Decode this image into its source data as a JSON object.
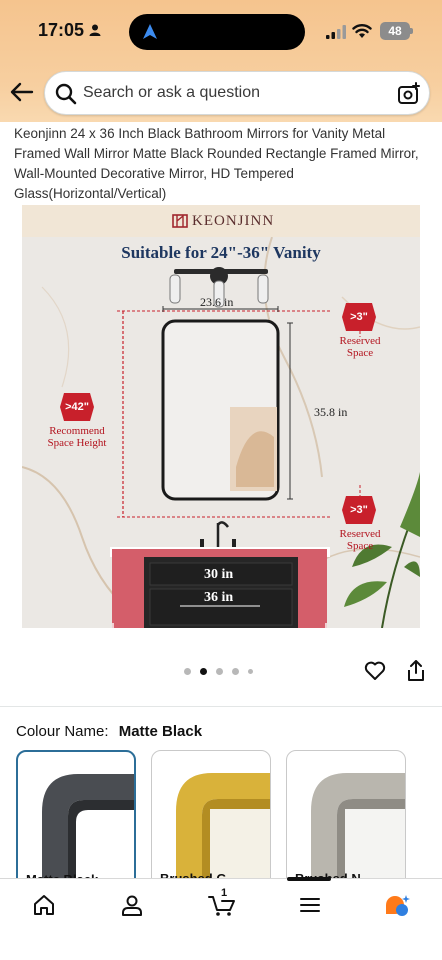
{
  "status_bar": {
    "time": "17:05",
    "battery": "48",
    "icons": [
      "person-icon",
      "location-arrow-icon",
      "signal-icon",
      "wifi-icon",
      "battery-icon"
    ]
  },
  "search": {
    "placeholder": "Search or ask a question",
    "back_icon": "back-arrow-icon",
    "search_icon": "search-icon",
    "camera_icon": "camera-lens-icon"
  },
  "product": {
    "title": "Keonjinn 24 x 36 Inch Black Bathroom Mirrors for Vanity Metal Framed Wall Mirror Matte Black Rounded Rectangle Framed Mirror, Wall-Mounted Decorative Mirror, HD Tempered Glass(Horizontal/Vertical)"
  },
  "image": {
    "brand": "KEONJINN",
    "headline": "Suitable for 24\"-36\" Vanity",
    "mirror_width": "23.6 in",
    "mirror_height": "35.8 in",
    "left_badge": ">42\"",
    "left_note_line1": "Recommend",
    "left_note_line2": "Space Height",
    "top_badge": ">3\"",
    "top_note_line1": "Reserved",
    "top_note_line2": "Space",
    "bottom_badge": ">3\"",
    "bottom_note_line1": "Reserved",
    "bottom_note_line2": "Space",
    "vanity_width_inner": "30 in",
    "vanity_width_outer": "36 in"
  },
  "gallery": {
    "dot_count": 5,
    "active_dot": 2,
    "heart_icon": "heart-icon",
    "share_icon": "share-icon"
  },
  "colour": {
    "label": "Colour Name:",
    "value": "Matte Black",
    "swatches": [
      {
        "label": "Matte Black",
        "color": "#4a4d52",
        "selected": true
      },
      {
        "label": "Brushed G",
        "color": "#d9b23a",
        "selected": false
      },
      {
        "label": "Brushed N",
        "color": "#b9b6ae",
        "selected": false
      }
    ]
  },
  "bottom_nav": {
    "cart_count": "1",
    "items": [
      "home-icon",
      "account-icon",
      "cart-icon",
      "menu-icon",
      "rufus-assistant-icon"
    ]
  },
  "colors": {
    "header_gradient_top": "#f5c48e",
    "accent_red": "#c8202b",
    "selected_border": "#2c6e98",
    "headline_blue": "#1e3760"
  }
}
